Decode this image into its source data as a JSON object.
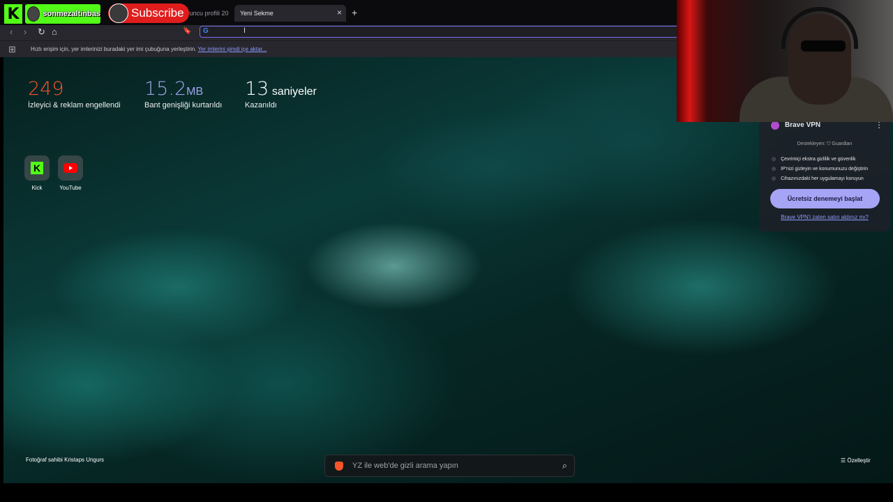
{
  "tabs": {
    "inactive_label": "oyuncu profili 20",
    "active_label": "Yeni Sekme",
    "close_glyph": "×",
    "new_tab_glyph": "+"
  },
  "overlay": {
    "kick_letter": "K",
    "channel_name": "sonmezaltinbas",
    "subscribe_label": "Subscribe"
  },
  "toolbar": {
    "back_glyph": "‹",
    "forward_glyph": "›",
    "reload_glyph": "↻",
    "home_glyph": "⌂",
    "bookmark_glyph": "🔖",
    "search_engine_glyph": "G",
    "cursor_glyph": "I"
  },
  "bookmarks_bar": {
    "hint": "Hızlı erişim için, yer imlerinizi buradaki yer imi çubuğuna yerleştirin.",
    "import_link": "Yer imlerini şimdi içe aktar..."
  },
  "stats": [
    {
      "number": "249",
      "unit": "",
      "label": "İzleyici & reklam engellendi",
      "color": "#fb542b"
    },
    {
      "number": "15.2",
      "unit": "MB",
      "label": "Bant genişliği kurtarıldı",
      "color": "#a0a5eb"
    },
    {
      "number": "13",
      "unit": "saniyeler",
      "label": "Kazanıldı",
      "color": "#ffffff"
    }
  ],
  "shortcuts": [
    {
      "label": "Kick",
      "icon": "kick-icon"
    },
    {
      "label": "YouTube",
      "icon": "youtube-icon"
    }
  ],
  "vpn": {
    "title": "Brave VPN",
    "more_glyph": "⋮",
    "sponsor": "Destekleyen: ⛉ Guardian",
    "features": [
      "Çevrimiçi ekstra gizlilik ve güvenlik",
      "IP'nizi gizleyin ve konumunuzu değiştirin",
      "Cihazınızdaki her uygulamayı koruyun"
    ],
    "cta": "Ücretsiz denemeyi başlat",
    "owned_link": "Brave VPN'i zaten satın aldınız mı?"
  },
  "photo_credit": "Fotoğraf sahibi Kristaps Ungurs",
  "search": {
    "placeholder": "YZ ile web'de gizli arama yapın",
    "search_glyph": "⌕"
  },
  "customize": "☰ Özelleştir"
}
